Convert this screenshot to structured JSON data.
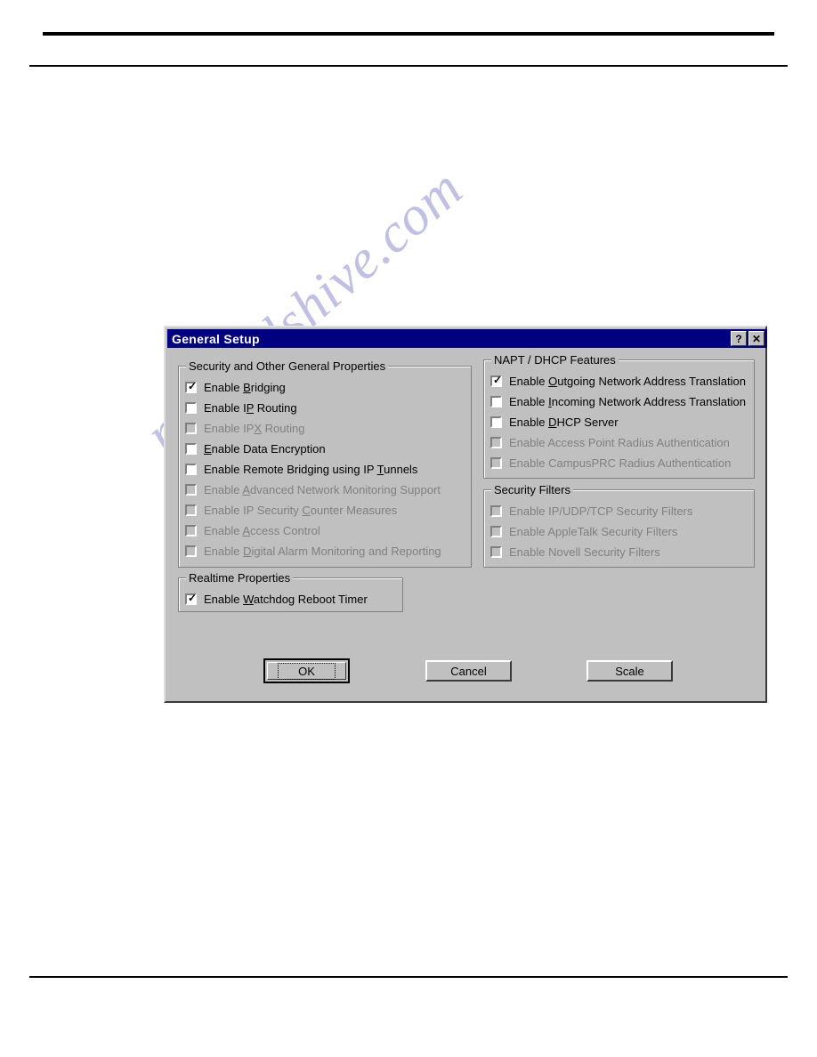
{
  "page": {
    "rules": [
      "top-thick-rule",
      "top-thin-rule",
      "bottom-rule"
    ],
    "watermark": "manualshive.com"
  },
  "dialog": {
    "title": "General Setup",
    "titlebar_color": "#000080",
    "face_color": "#c0c0c0",
    "help_button": "?",
    "close_button": "✕",
    "groups": {
      "security": {
        "title": "Security and Other General Properties",
        "items": [
          {
            "label": "Enable Bridging",
            "accel": "B",
            "checked": true,
            "enabled": true
          },
          {
            "label": "Enable IP Routing",
            "accel": "P",
            "checked": false,
            "enabled": true
          },
          {
            "label": "Enable IPX Routing",
            "accel": "X",
            "checked": false,
            "enabled": false
          },
          {
            "label": "Enable Data Encryption",
            "accel": "E",
            "checked": false,
            "enabled": true
          },
          {
            "label": "Enable Remote Bridging using IP Tunnels",
            "accel": "T",
            "checked": false,
            "enabled": true
          },
          {
            "label": "Enable Advanced Network Monitoring Support",
            "accel": "A",
            "checked": false,
            "enabled": false
          },
          {
            "label": "Enable IP Security Counter Measures",
            "accel": "C",
            "checked": false,
            "enabled": false
          },
          {
            "label": "Enable Access Control",
            "accel": "A",
            "checked": false,
            "enabled": false
          },
          {
            "label": "Enable Digital Alarm Monitoring and Reporting",
            "accel": "D",
            "checked": false,
            "enabled": false
          }
        ]
      },
      "realtime": {
        "title": "Realtime Properties",
        "items": [
          {
            "label": "Enable Watchdog Reboot Timer",
            "accel": "W",
            "checked": true,
            "enabled": true
          }
        ]
      },
      "napt": {
        "title": "NAPT / DHCP Features",
        "items": [
          {
            "label": "Enable Outgoing Network Address Translation",
            "accel": "O",
            "checked": true,
            "enabled": true
          },
          {
            "label": "Enable Incoming Network Address Translation",
            "accel": "I",
            "checked": false,
            "enabled": true
          },
          {
            "label": "Enable DHCP Server",
            "accel": "D",
            "checked": false,
            "enabled": true
          },
          {
            "label": "Enable Access Point Radius Authentication",
            "accel": "",
            "checked": false,
            "enabled": false
          },
          {
            "label": "Enable CampusPRC Radius Authentication",
            "accel": "",
            "checked": false,
            "enabled": false
          }
        ]
      },
      "filters": {
        "title": "Security Filters",
        "items": [
          {
            "label": "Enable IP/UDP/TCP Security Filters",
            "accel": "",
            "checked": false,
            "enabled": false
          },
          {
            "label": "Enable AppleTalk Security Filters",
            "accel": "",
            "checked": false,
            "enabled": false
          },
          {
            "label": "Enable Novell Security Filters",
            "accel": "",
            "checked": false,
            "enabled": false
          }
        ]
      }
    },
    "buttons": {
      "ok": "OK",
      "cancel": "Cancel",
      "scale": "Scale"
    }
  }
}
